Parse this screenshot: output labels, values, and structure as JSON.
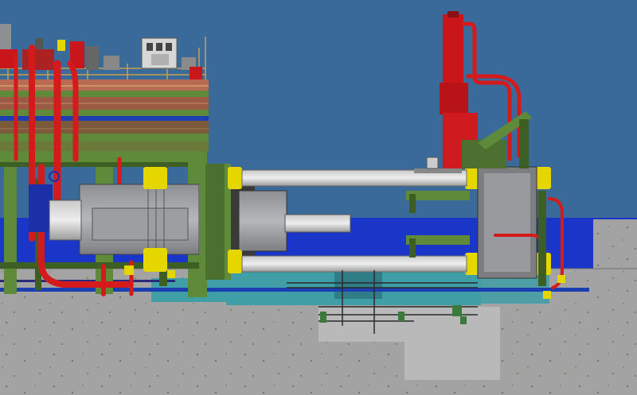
{
  "scene": {
    "subject": "extrusion-press-cad-elevation",
    "colors": {
      "background": "#3a6a9a",
      "frame_green": "#5f8a3a",
      "frame_dark": "#3e5f24",
      "hydraulic_red": "#c8161a",
      "pipe_red": "#d41a1a",
      "steel_gray": "#a9aaad",
      "steel_dark": "#707176",
      "cylinder_light": "#d8d8d8",
      "yellow_flange": "#e6d600",
      "cyan_base": "#3f9ea6",
      "deck_blue": "#1b3fb0",
      "floor_band": "#1a36c8",
      "concrete": "#a3a3a3",
      "pit": "#b9b9b9"
    }
  }
}
